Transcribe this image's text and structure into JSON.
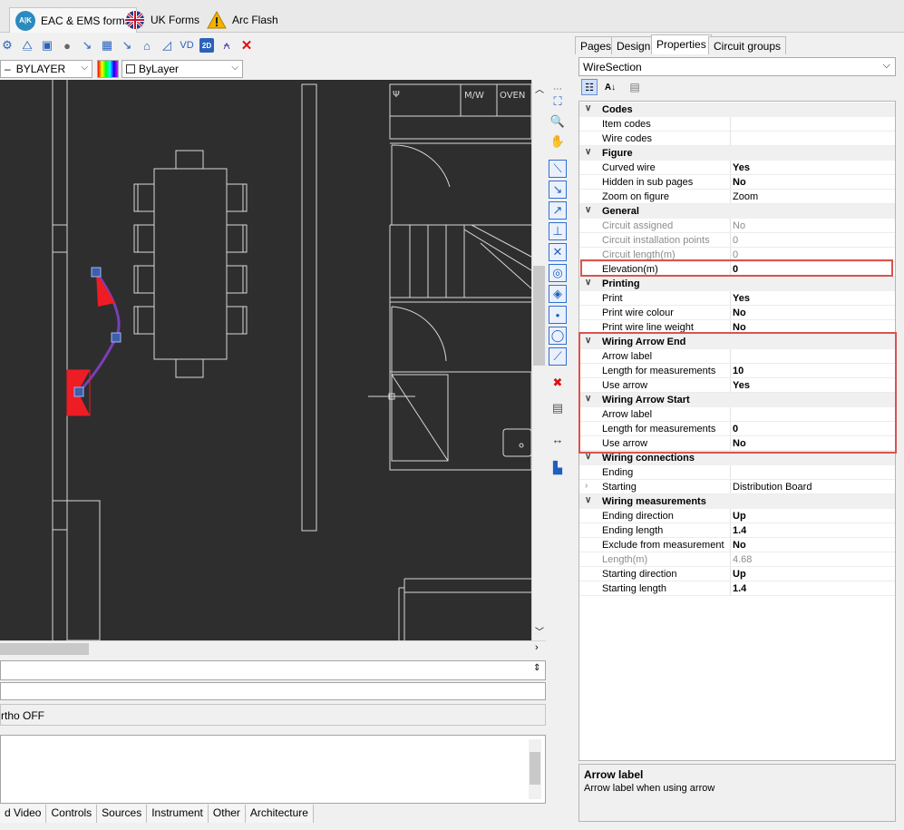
{
  "ribbon": {
    "tabs": [
      {
        "label": "EAC & EMS forms",
        "icon": "eac-logo-icon"
      },
      {
        "label": "UK Forms",
        "icon": "uk-flag-icon"
      },
      {
        "label": "Arc Flash",
        "icon": "warning-icon"
      }
    ]
  },
  "layer_bar": {
    "layer_value": "BYLAYER",
    "linetype_value": "ByLayer"
  },
  "canvas": {
    "labels": [
      "Ψ",
      "M/W",
      "OVEN"
    ]
  },
  "command": {
    "status_text": "rtho OFF"
  },
  "bottom_tabs": [
    "d Video",
    "Controls",
    "Sources",
    "Instrument",
    "Other",
    "Architecture"
  ],
  "panel": {
    "tabs": [
      "Pages",
      "Design",
      "Properties",
      "Circuit groups"
    ],
    "active_tab": "Properties",
    "selector": "WireSection",
    "categories": [
      {
        "name": "Codes",
        "rows": [
          {
            "name": "Item codes",
            "value": ""
          },
          {
            "name": "Wire codes",
            "value": ""
          }
        ]
      },
      {
        "name": "Figure",
        "rows": [
          {
            "name": "Curved wire",
            "value": "Yes"
          },
          {
            "name": "Hidden in sub pages",
            "value": "No"
          },
          {
            "name": "Zoom on figure",
            "value": "Zoom"
          }
        ]
      },
      {
        "name": "General",
        "rows": [
          {
            "name": "Circuit assigned",
            "value": "No"
          },
          {
            "name": "Circuit installation points",
            "value": "0"
          },
          {
            "name": "Circuit length(m)",
            "value": "0"
          },
          {
            "name": "Elevation(m)",
            "value": "0"
          }
        ]
      },
      {
        "name": "Printing",
        "rows": [
          {
            "name": "Print",
            "value": "Yes"
          },
          {
            "name": "Print wire colour",
            "value": "No"
          },
          {
            "name": "Print wire line weight",
            "value": "No"
          }
        ]
      },
      {
        "name": "Wiring Arrow End",
        "rows": [
          {
            "name": "Arrow label",
            "value": ""
          },
          {
            "name": "Length for measurements",
            "value": "10"
          },
          {
            "name": "Use arrow",
            "value": "Yes"
          }
        ]
      },
      {
        "name": "Wiring Arrow Start",
        "rows": [
          {
            "name": "Arrow label",
            "value": ""
          },
          {
            "name": "Length for measurements",
            "value": "0"
          },
          {
            "name": "Use arrow",
            "value": "No"
          }
        ]
      },
      {
        "name": "Wiring connections",
        "rows": [
          {
            "name": "Ending",
            "value": ""
          },
          {
            "name": "Starting",
            "value": "Distribution Board"
          }
        ]
      },
      {
        "name": "Wiring measurements",
        "rows": [
          {
            "name": "Ending direction",
            "value": "Up"
          },
          {
            "name": "Ending length",
            "value": "1.4"
          },
          {
            "name": "Exclude from measurement",
            "value": "No"
          },
          {
            "name": "Length(m)",
            "value": "4.68"
          },
          {
            "name": "Starting direction",
            "value": "Up"
          },
          {
            "name": "Starting length",
            "value": "1.4"
          }
        ]
      }
    ],
    "description": {
      "title": "Arrow label",
      "text": "Arrow label when using arrow"
    }
  }
}
